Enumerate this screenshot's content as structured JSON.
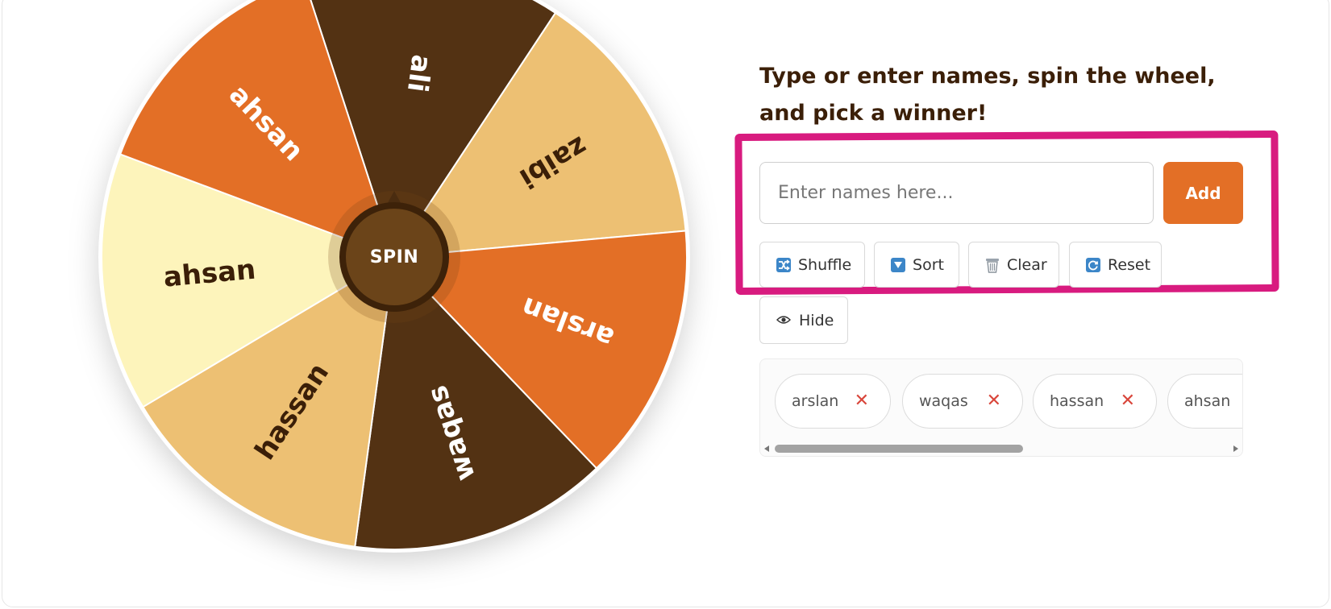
{
  "colors": {
    "accent": "#e36f26",
    "highlight": "#d81b7f",
    "dark_brown": "#533213",
    "light_tan": "#edc073",
    "cream": "#fdf4bb",
    "orange": "#e36f26",
    "remove_x": "#d9463b"
  },
  "wheel": {
    "spin_label": "SPIN",
    "segments": [
      {
        "label": "ali",
        "color": "#533213",
        "text_color": "#ffffff"
      },
      {
        "label": "zaibi",
        "color": "#edc073",
        "text_color": "#3b1f08"
      },
      {
        "label": "arslan",
        "color": "#e36f26",
        "text_color": "#ffffff"
      },
      {
        "label": "waqas",
        "color": "#533213",
        "text_color": "#ffffff"
      },
      {
        "label": "hassan",
        "color": "#edc073",
        "text_color": "#3b1f08"
      },
      {
        "label": "ahsan",
        "color": "#fdf4bb",
        "text_color": "#3b1f08"
      },
      {
        "label": "ahsan",
        "color": "#e36f26",
        "text_color": "#ffffff"
      }
    ]
  },
  "panel": {
    "heading": "Type or enter names, spin the wheel, and pick a winner!",
    "input_placeholder": "Enter names here...",
    "add_label": "Add",
    "tools": {
      "shuffle_label": "Shuffle",
      "sort_label": "Sort",
      "clear_label": "Clear",
      "reset_label": "Reset",
      "hide_label": "Hide"
    },
    "icons": {
      "shuffle": "shuffle-icon",
      "sort": "sort-icon",
      "clear": "trash-icon",
      "reset": "reset-icon",
      "hide": "eye-icon",
      "remove": "close-icon"
    }
  },
  "names": [
    {
      "label": "arslan",
      "remove": "✕"
    },
    {
      "label": "waqas",
      "remove": "✕"
    },
    {
      "label": "hassan",
      "remove": "✕"
    },
    {
      "label": "ahsan",
      "remove": "✕"
    }
  ]
}
